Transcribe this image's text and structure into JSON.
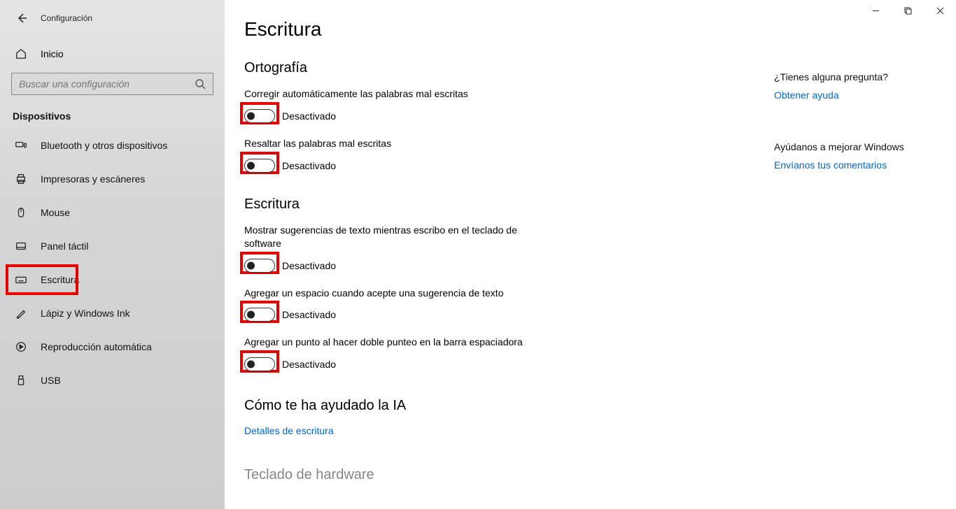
{
  "window": {
    "title": "Configuración"
  },
  "sidebar": {
    "home": "Inicio",
    "search_placeholder": "Buscar una configuración",
    "category": "Dispositivos",
    "items": [
      {
        "label": "Bluetooth y otros dispositivos"
      },
      {
        "label": "Impresoras y escáneres"
      },
      {
        "label": "Mouse"
      },
      {
        "label": "Panel táctil"
      },
      {
        "label": "Escritura"
      },
      {
        "label": "Lápiz y Windows Ink"
      },
      {
        "label": "Reproducción automática"
      },
      {
        "label": "USB"
      }
    ]
  },
  "page": {
    "title": "Escritura",
    "sections": {
      "spelling": {
        "header": "Ortografía",
        "s1_label": "Corregir automáticamente las palabras mal escritas",
        "s1_state": "Desactivado",
        "s2_label": "Resaltar las palabras mal escritas",
        "s2_state": "Desactivado"
      },
      "typing": {
        "header": "Escritura",
        "s1_label": "Mostrar sugerencias de texto mientras escribo en el teclado de software",
        "s1_state": "Desactivado",
        "s2_label": "Agregar un espacio cuando acepte una sugerencia de texto",
        "s2_state": "Desactivado",
        "s3_label": "Agregar un punto al hacer doble punteo en la barra espaciadora",
        "s3_state": "Desactivado"
      },
      "ai": {
        "header": "Cómo te ha ayudado la IA",
        "link": "Detalles de escritura"
      },
      "hw": {
        "header": "Teclado de hardware"
      }
    }
  },
  "aside": {
    "help_q": "¿Tienes alguna pregunta?",
    "help_link": "Obtener ayuda",
    "feedback_q": "Ayúdanos a mejorar Windows",
    "feedback_link": "Envíanos tus comentarios"
  }
}
